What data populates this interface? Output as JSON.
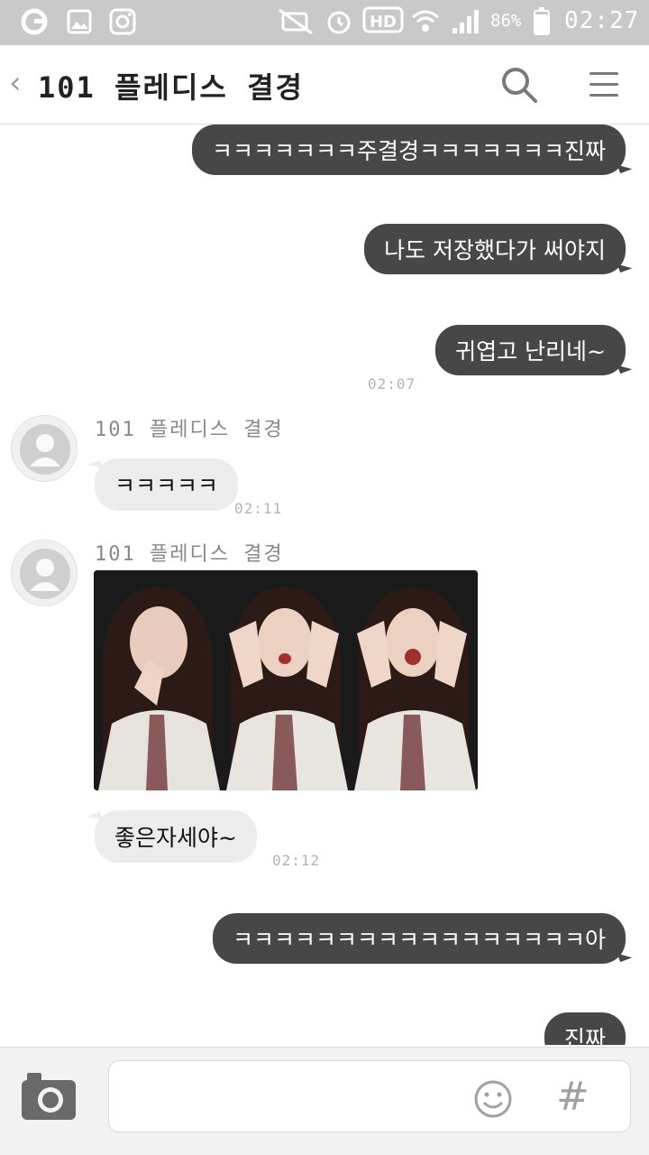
{
  "status_bar": {
    "battery_percent": "86%",
    "battery_level": 0.86,
    "time": "02:27",
    "icons": [
      "kakao-icon",
      "gallery-icon",
      "instagram-icon",
      "mute-icon",
      "alarm-icon",
      "hd-icon",
      "wifi-icon",
      "signal-icon",
      "battery-icon"
    ]
  },
  "header": {
    "back_label": "‹",
    "title": "101 플레디스 결경"
  },
  "messages": {
    "out_1": "ㅋㅋㅋㅋㅋㅋㅋ주결경ㅋㅋㅋㅋㅋㅋㅋ진짜",
    "out_2": "나도 저장했다가 써야지",
    "out_3": "귀엽고 난리네~",
    "out_3_time": "02:07",
    "in_1_sender": "101 플레디스 결경",
    "in_1_text": "ㅋㅋㅋㅋㅋ",
    "in_1_time": "02:11",
    "in_2_sender": "101 플레디스 결경",
    "in_2_text": "좋은자세야~",
    "in_2_time": "02:12",
    "out_4": "ㅋㅋㅋㅋㅋㅋㅋㅋㅋㅋㅋㅋㅋㅋㅋㅋㅋ아",
    "out_5": "진짜"
  },
  "colors": {
    "status_bar": "#c9c9c9",
    "outgoing_bubble": "#474747",
    "incoming_bubble": "#ececec",
    "bottom_bar": "#f2f2f2"
  }
}
